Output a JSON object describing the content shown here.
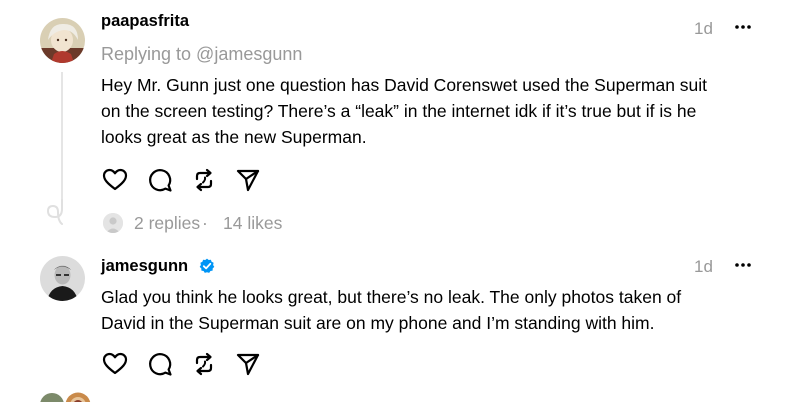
{
  "posts": [
    {
      "username": "paapasfrita",
      "replying_to": "Replying to @jamesgunn",
      "time": "1d",
      "body_lines": [
        "Hey Mr. Gunn just one question has David Corenswet used the Superman suit",
        "on the screen testing? There’s a “leak” in the internet idk if it’s true but if is he",
        "looks great as the new Superman."
      ],
      "stats": {
        "replies": "2 replies",
        "separator": "·",
        "likes": "14 likes"
      }
    },
    {
      "username": "jamesgunn",
      "verified": true,
      "time": "1d",
      "body_lines": [
        "Glad you think he looks great, but there’s no leak. The only photos taken of",
        "David in the Superman suit are on my phone and I’m standing with him."
      ]
    }
  ],
  "icons": {
    "more": "more-horizontal-icon",
    "like": "heart-icon",
    "reply": "speech-bubble-icon",
    "repost": "repost-icon",
    "share": "send-icon",
    "verified": "verified-badge-icon"
  },
  "colors": {
    "text": "#000000",
    "muted": "#999999",
    "verified": "#0095f6",
    "thread_line": "#e5e5e5"
  }
}
